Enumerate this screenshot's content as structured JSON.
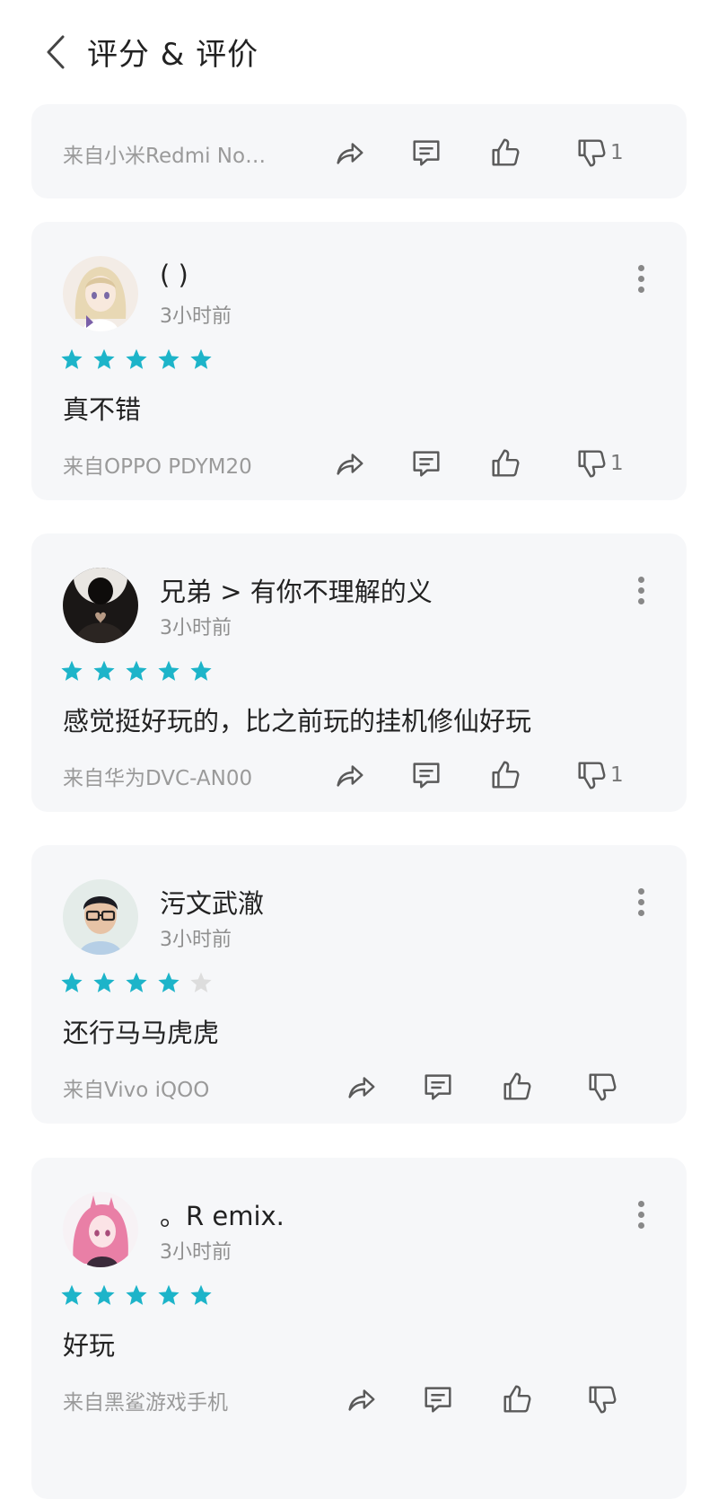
{
  "header": {
    "title": "评分 & 评价"
  },
  "colors": {
    "star_on": "#1db4c9",
    "star_off": "#dddddd",
    "card_bg": "#f6f7f9"
  },
  "partial_card": {
    "device": "来自小米Redmi No…",
    "dislike_count": "1"
  },
  "reviews": [
    {
      "name": "(           )",
      "time": "3小时前",
      "rating": 5,
      "text": "真不错",
      "device": "来自OPPO PDYM20",
      "dislike_count": "1"
    },
    {
      "name": "兄弟 > 有你不理解的义",
      "time": "3小时前",
      "rating": 5,
      "text": "感觉挺好玩的，比之前玩的挂机修仙好玩",
      "device": "来自华为DVC-AN00",
      "dislike_count": "1"
    },
    {
      "name": "污文武澈",
      "time": "3小时前",
      "rating": 4,
      "text": "还行马马虎虎",
      "device": "来自Vivo iQOO",
      "dislike_count": ""
    },
    {
      "name": "。R emix.",
      "time": "3小时前",
      "rating": 5,
      "text": "好玩",
      "device": "来自黑鲨游戏手机",
      "dislike_count": ""
    }
  ]
}
